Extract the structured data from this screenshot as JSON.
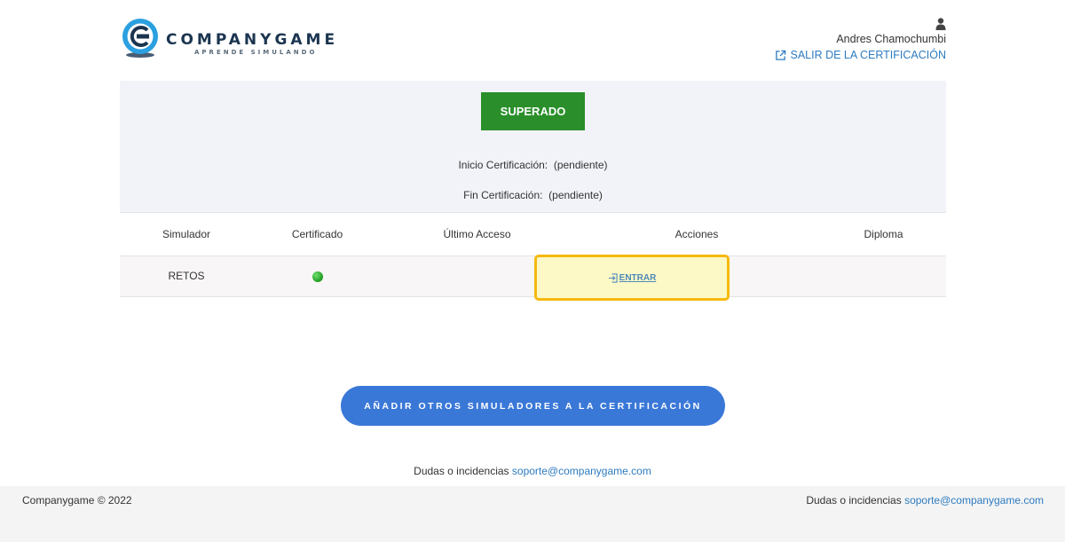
{
  "brand": {
    "name": "COMPANYGAME",
    "tagline": "APRENDE SIMULANDO",
    "logo_color": "#1b3550",
    "logo_accent": "#2aa0e0"
  },
  "user": {
    "icon": "user-icon",
    "name": "Andres Chamochumbi",
    "logout_label": "SALIR DE LA CERTIFICACIÓN",
    "logout_icon": "external-link-icon"
  },
  "status": {
    "badge_label": "SUPERADO",
    "badge_color": "#2a8f2a",
    "start_label": "Inicio Certificación:",
    "start_value": "(pendiente)",
    "end_label": "Fin Certificación:",
    "end_value": "(pendiente)"
  },
  "table": {
    "headers": [
      "Simulador",
      "Certificado",
      "Último Acceso",
      "Acciones",
      "Diploma"
    ],
    "rows": [
      {
        "simulador": "RETOS",
        "certificado": "green-dot",
        "ultimo_acceso": "",
        "accion_label": "ENTRAR",
        "accion_icon": "sign-in-icon",
        "diploma": ""
      }
    ]
  },
  "highlight_color": "#f6b90f",
  "add_button_label": "AÑADIR OTROS SIMULADORES A LA CERTIFICACIÓN",
  "support": {
    "label": "Dudas o incidencias",
    "email": "soporte@companygame.com"
  },
  "footer": {
    "copyright": "Companygame © 2022",
    "support_label": "Dudas o incidencias",
    "support_email": "soporte@companygame.com"
  }
}
